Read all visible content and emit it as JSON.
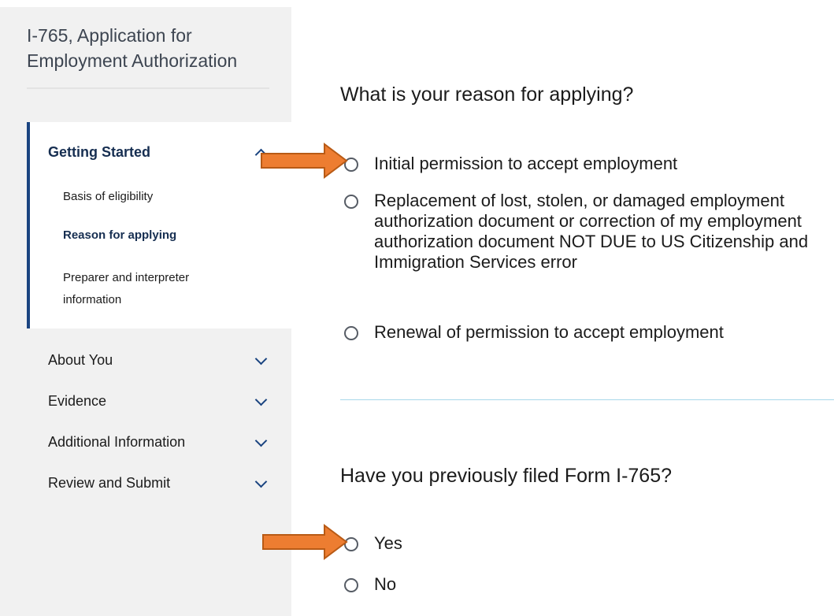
{
  "sidebar": {
    "title": "I-765, Application for Employment Authorization",
    "sections": [
      {
        "label": "Getting Started",
        "expanded": true,
        "icon": "chevron-up-icon",
        "items": [
          "Basis of eligibility",
          "Reason for applying",
          "Preparer and interpreter information"
        ],
        "current_item": "Reason for applying"
      },
      {
        "label": "About You",
        "expanded": false,
        "icon": "chevron-down-icon"
      },
      {
        "label": "Evidence",
        "expanded": false,
        "icon": "chevron-down-icon"
      },
      {
        "label": "Additional Information",
        "expanded": false,
        "icon": "chevron-down-icon"
      },
      {
        "label": "Review and Submit",
        "expanded": false,
        "icon": "chevron-down-icon"
      }
    ]
  },
  "main": {
    "q1": {
      "text": "What is your reason for applying?",
      "options": [
        "Initial permission to accept employment",
        "Replacement of lost, stolen, or damaged employment authorization document or correction of my employment authorization document NOT DUE to US Citizenship and Immigration Services error",
        "Renewal of permission to accept employment"
      ]
    },
    "q2": {
      "text": "Have you previously filed Form I-765?",
      "options": [
        "Yes",
        "No"
      ]
    }
  },
  "annotations": {
    "arrow_color": "#ed7d31",
    "arrow_stroke": "#b85a15"
  },
  "colors": {
    "accent": "#1a4480",
    "sidebar_bg": "#f1f1f1",
    "divider": "#a8d8ea"
  }
}
